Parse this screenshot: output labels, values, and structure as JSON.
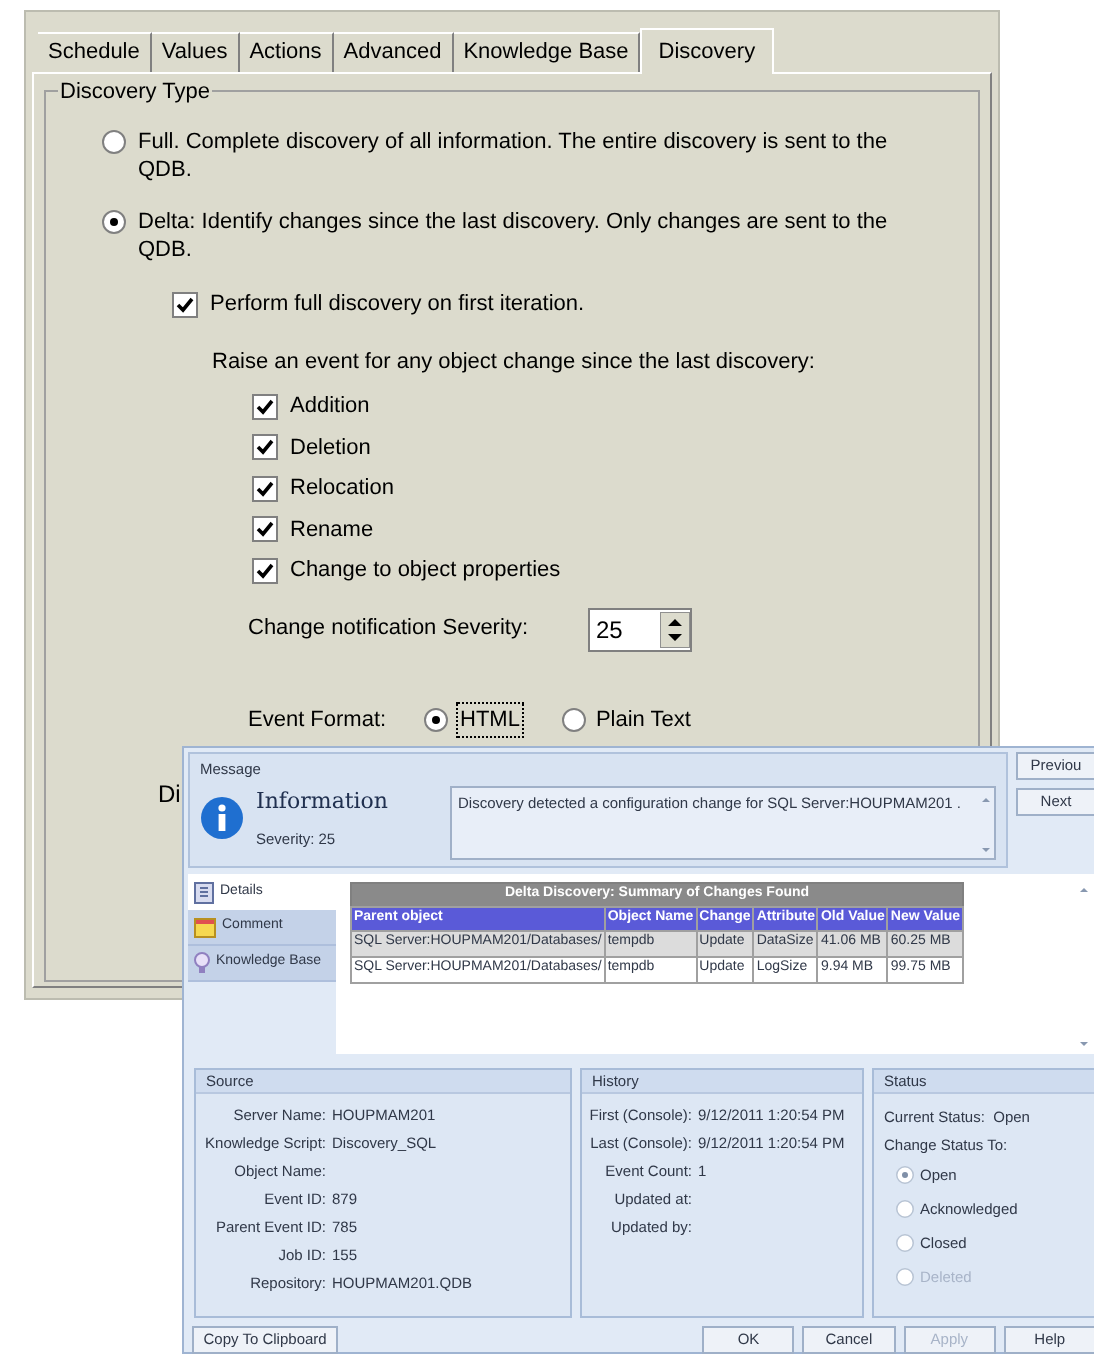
{
  "dialog": {
    "tabs": [
      {
        "label": "Schedule",
        "selected": false
      },
      {
        "label": "Values",
        "selected": false
      },
      {
        "label": "Actions",
        "selected": false
      },
      {
        "label": "Advanced",
        "selected": false
      },
      {
        "label": "Knowledge Base",
        "selected": false
      },
      {
        "label": "Discovery",
        "selected": true
      }
    ],
    "group_title": "Discovery Type",
    "discovery_options": [
      {
        "label": "Full. Complete discovery of all information.  The entire discovery is sent to the QDB.",
        "selected": false
      },
      {
        "label": "Delta: Identify changes since the last discovery.  Only changes are sent to the QDB.",
        "selected": true
      }
    ],
    "first_iteration": {
      "label": "Perform full discovery on first iteration.",
      "checked": true
    },
    "raise_label": "Raise an event for any object change since the last discovery:",
    "change_events": [
      {
        "label": "Addition",
        "checked": true
      },
      {
        "label": "Deletion",
        "checked": true
      },
      {
        "label": "Relocation",
        "checked": true
      },
      {
        "label": "Rename",
        "checked": true
      },
      {
        "label": "Change to object properties",
        "checked": true
      }
    ],
    "severity": {
      "label": "Change notification Severity:",
      "value": "25"
    },
    "event_format": {
      "label": "Event Format:",
      "options": [
        {
          "label": "HTML",
          "selected": true
        },
        {
          "label": "Plain Text",
          "selected": false
        }
      ]
    },
    "cut_label": "Di"
  },
  "event_window": {
    "message": {
      "title": "Message",
      "type": "Information",
      "severity": "Severity: 25",
      "text": "Discovery detected a configuration change for SQL Server:HOUPMAM201 ."
    },
    "nav_buttons": [
      "Previou",
      "Next"
    ],
    "side_tabs": [
      {
        "label": "Details",
        "selected": true
      },
      {
        "label": "Comment",
        "selected": false
      },
      {
        "label": "Knowledge Base",
        "selected": false
      }
    ],
    "table": {
      "title": "Delta Discovery: Summary of Changes Found",
      "columns": [
        "Parent object",
        "Object Name",
        "Change",
        "Attribute",
        "Old Value",
        "New Value"
      ],
      "rows": [
        [
          "SQL Server:HOUPMAM201/Databases/",
          "tempdb",
          "Update",
          "DataSize",
          "41.06 MB",
          "60.25 MB"
        ],
        [
          "SQL Server:HOUPMAM201/Databases/",
          "tempdb",
          "Update",
          "LogSize",
          "9.94 MB",
          "99.75 MB"
        ]
      ]
    },
    "source": {
      "title": "Source",
      "fields": [
        {
          "label": "Server Name:",
          "value": "HOUPMAM201"
        },
        {
          "label": "Knowledge Script:",
          "value": "Discovery_SQL"
        },
        {
          "label": "Object Name:"
        },
        {
          "label": "Event ID:",
          "value": "879"
        },
        {
          "label": "Parent Event ID:",
          "value": "785"
        },
        {
          "label": "Job ID:",
          "value": "155"
        },
        {
          "label": "Repository:",
          "value": "HOUPMAM201.QDB"
        }
      ]
    },
    "history": {
      "title": "History",
      "fields": [
        {
          "label": "First (Console):",
          "value": "9/12/2011 1:20:54 PM"
        },
        {
          "label": "Last (Console):",
          "value": "9/12/2011 1:20:54 PM"
        },
        {
          "label": "Event Count:",
          "value": "1"
        },
        {
          "label": "Updated at:"
        },
        {
          "label": "Updated by:"
        }
      ]
    },
    "status": {
      "title": "Status",
      "current": "Current Status:  Open",
      "change_label": "Change Status To:",
      "options": [
        {
          "label": "Open",
          "selected": true,
          "disabled": false
        },
        {
          "label": "Acknowledged",
          "selected": false,
          "disabled": false
        },
        {
          "label": "Closed",
          "selected": false,
          "disabled": false
        },
        {
          "label": "Deleted",
          "selected": false,
          "disabled": true
        }
      ]
    },
    "buttons": [
      {
        "label": "Copy To Clipboard",
        "disabled": false
      },
      {
        "label": "OK",
        "disabled": false
      },
      {
        "label": "Cancel",
        "disabled": false
      },
      {
        "label": "Apply",
        "disabled": true
      },
      {
        "label": "Help",
        "disabled": false
      }
    ]
  }
}
